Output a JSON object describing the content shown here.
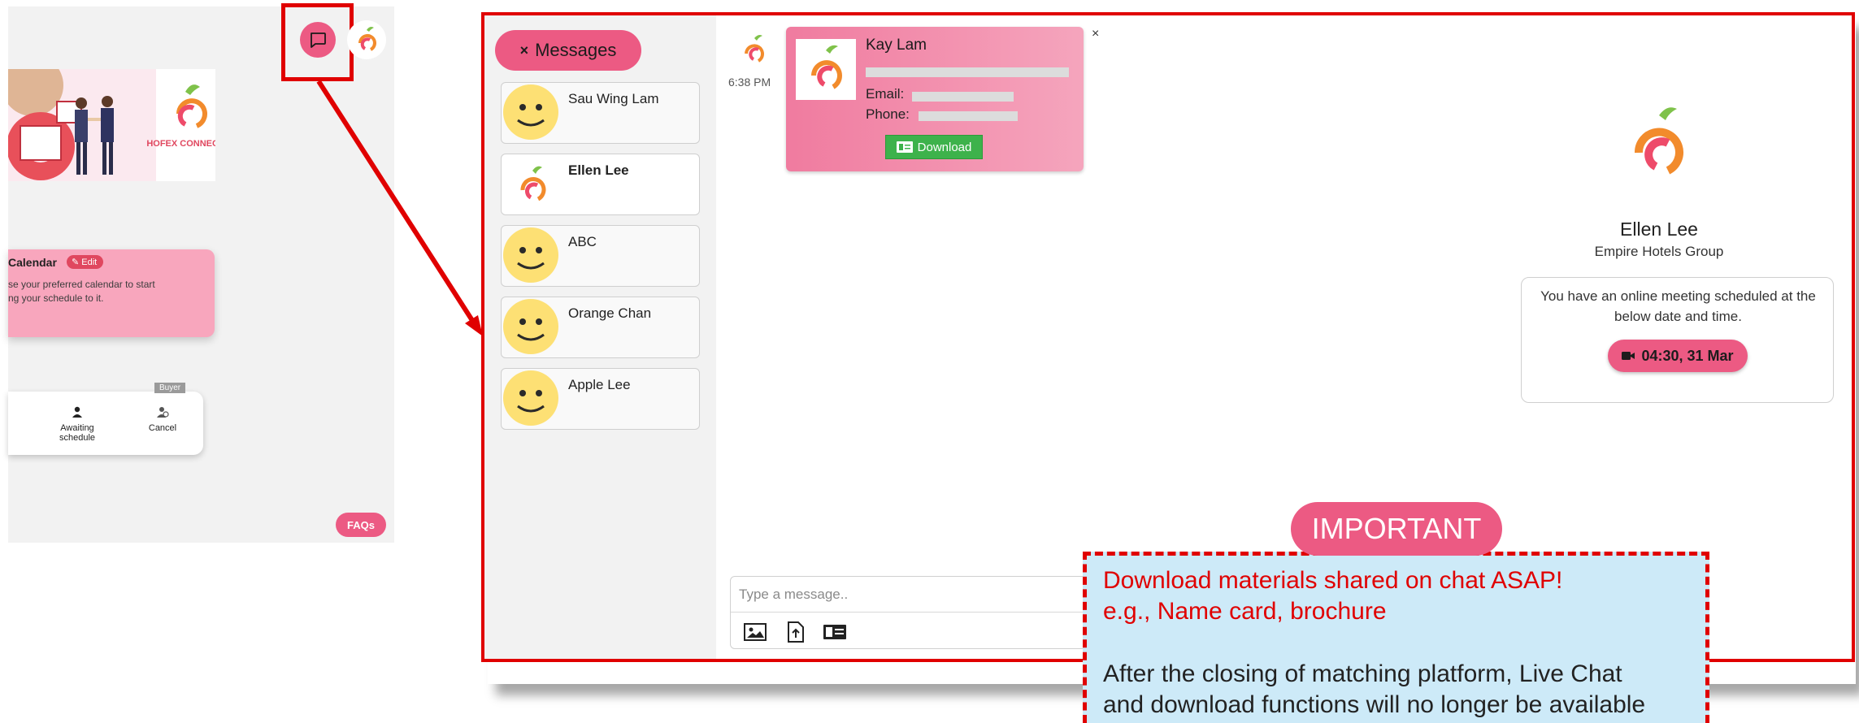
{
  "left": {
    "calendar": {
      "title": "Calendar",
      "edit_label": "Edit",
      "text_line1": "se your preferred calendar to start",
      "text_line2": "ng your schedule to it."
    },
    "schedule": {
      "buyer_badge": "Buyer",
      "awaiting_label": "Awaiting schedule",
      "cancel_label": "Cancel"
    },
    "banner_logo_text": "HOFEX CONNECT",
    "faqs_label": "FAQs"
  },
  "messages": {
    "tab_label": "Messages",
    "close_symbol": "×",
    "conversations": [
      {
        "name": "Sau Wing Lam",
        "avatar": "smiley-icon"
      },
      {
        "name": "Ellen Lee",
        "avatar": "apple-logo-icon",
        "active": true
      },
      {
        "name": "ABC",
        "avatar": "smiley-icon"
      },
      {
        "name": "Orange Chan",
        "avatar": "smiley-icon"
      },
      {
        "name": "Apple Lee",
        "avatar": "smiley-icon"
      }
    ]
  },
  "chat": {
    "time": "6:38 PM",
    "namecard": {
      "name": "Kay Lam",
      "email_label": "Email:",
      "phone_label": "Phone:",
      "download_label": "Download",
      "close": "×"
    },
    "input_placeholder": "Type a message.."
  },
  "profile": {
    "name": "Ellen Lee",
    "company": "Empire Hotels Group",
    "meeting_text": "You have an online meeting scheduled at the below date and time.",
    "meeting_time": "04:30, 31 Mar"
  },
  "callout": {
    "title": "IMPORTANT",
    "line1": "Download materials shared on chat ASAP!",
    "line2": "e.g., Name card, brochure",
    "line3": "After the closing of matching platform, Live Chat",
    "line4": "and download functions will no longer be available"
  },
  "colors": {
    "accent_pink": "#ec5a83",
    "highlight_red": "#e00000",
    "download_green": "#3db24b",
    "callout_bg": "#cdeaf8"
  }
}
